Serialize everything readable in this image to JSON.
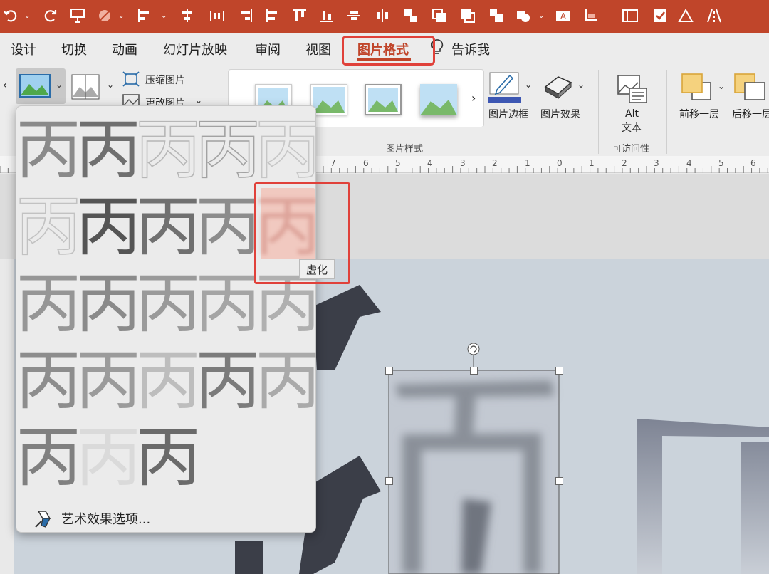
{
  "tabs": [
    "设计",
    "切换",
    "动画",
    "幻灯片放映",
    "审阅",
    "视图",
    "图片格式",
    "告诉我"
  ],
  "active_tab": "图片格式",
  "ribbon": {
    "compress_label": "压缩图片",
    "change_label": "更改图片",
    "border_label": "图片边框",
    "effects_label": "图片效果",
    "styles_group": "图片样式",
    "alt_label_1": "Alt",
    "alt_label_2": "文本",
    "accessibility_group": "可访问性",
    "bring_forward": "前移一层",
    "send_backward": "后移一层"
  },
  "ruler": [
    "7",
    "6",
    "5",
    "4",
    "3",
    "2",
    "1",
    "0",
    "1",
    "2",
    "3",
    "4",
    "5",
    "6"
  ],
  "dropdown": {
    "tooltip": "虚化",
    "art_options": "艺术效果选项..."
  },
  "glyph_char": "丙",
  "colors": {
    "accent": "#c0452a",
    "highlight": "#e0413a"
  }
}
